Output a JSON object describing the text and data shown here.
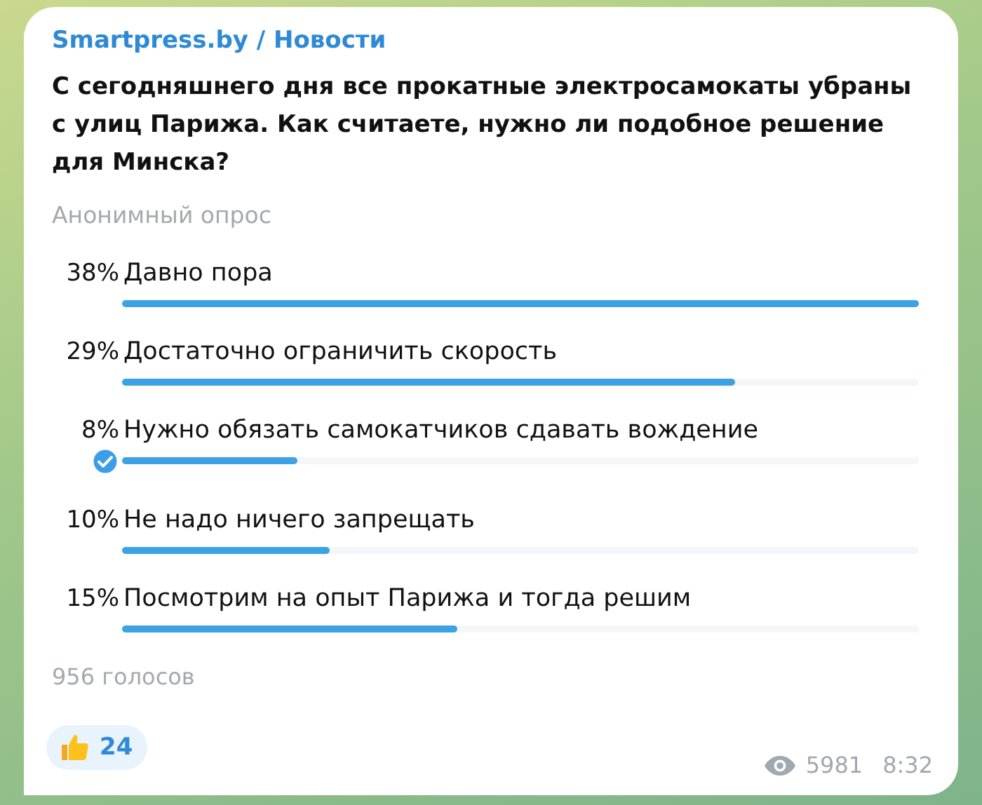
{
  "channel": "Smartpress.by / Новости",
  "question": "С сегодняшнего дня все прокатные электросамокаты убраны с улиц Парижа. Как считаете, нужно ли подобное решение для Минска?",
  "poll_type": "Анонимный опрос",
  "options": [
    {
      "percent": "38%",
      "label": "Давно пора",
      "level": 1.0,
      "selected": false
    },
    {
      "percent": "29%",
      "label": "Достаточно ограничить скорость",
      "level": 0.77,
      "selected": false
    },
    {
      "percent": "8%",
      "label": "Нужно обязать самокатчиков сдавать вождение",
      "level": 0.22,
      "selected": true
    },
    {
      "percent": "10%",
      "label": "Не надо ничего запрещать",
      "level": 0.26,
      "selected": false
    },
    {
      "percent": "15%",
      "label": "Посмотрим на опыт Парижа и тогда решим",
      "level": 0.42,
      "selected": false
    }
  ],
  "votes": "956 голосов",
  "reaction": {
    "count": "24"
  },
  "views": "5981",
  "time": "8:32"
}
